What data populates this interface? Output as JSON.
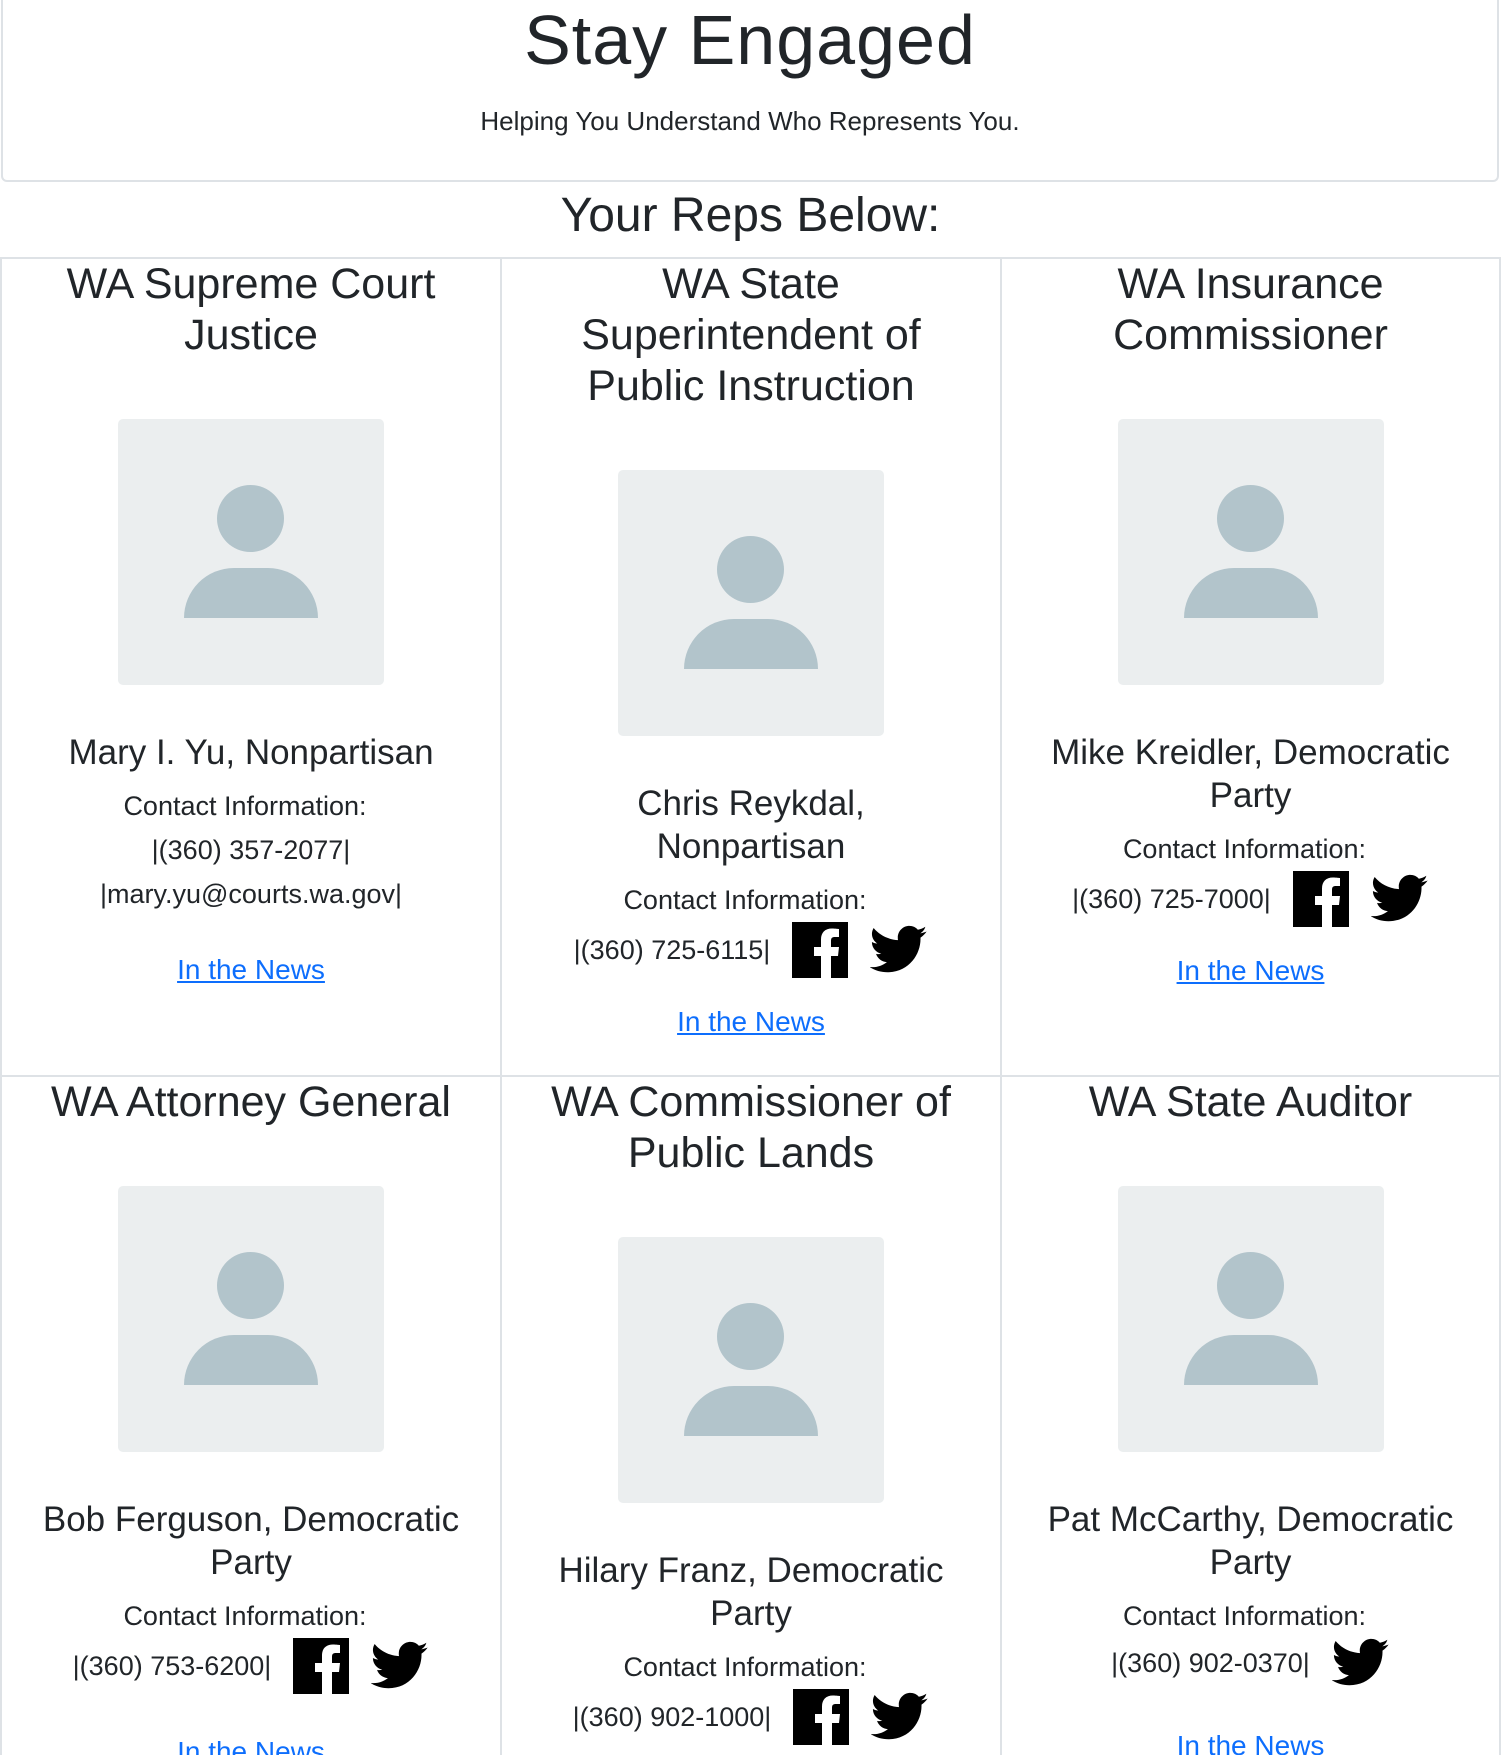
{
  "header": {
    "title": "Stay Engaged",
    "subtitle": "Helping You Understand Who Represents You."
  },
  "reps_heading": "Your Reps Below:",
  "contact_label": "Contact Information:",
  "news_label": "In the News",
  "reps": [
    {
      "office": "WA Supreme Court Justice",
      "name": "Mary I. Yu, Nonpartisan",
      "phone": "|(360) 357-2077|",
      "email": "|mary.yu@courts.wa.gov|"
    },
    {
      "office": "WA State Superintendent of Public Instruction",
      "name": "Chris Reykdal, Nonpartisan",
      "phone": "|(360) 725-6115|"
    },
    {
      "office": "WA Insurance Commissioner",
      "name": "Mike Kreidler, Democratic Party",
      "phone": "|(360) 725-7000|"
    },
    {
      "office": "WA Attorney General",
      "name": "Bob Ferguson, Democratic Party",
      "phone": "|(360) 753-6200|"
    },
    {
      "office": "WA Commissioner of Public Lands",
      "name": "Hilary Franz, Democratic Party",
      "phone": "|(360) 902-1000|"
    },
    {
      "office": "WA State Auditor",
      "name": "Pat McCarthy, Democratic Party",
      "phone": "|(360) 902-0370|"
    }
  ]
}
